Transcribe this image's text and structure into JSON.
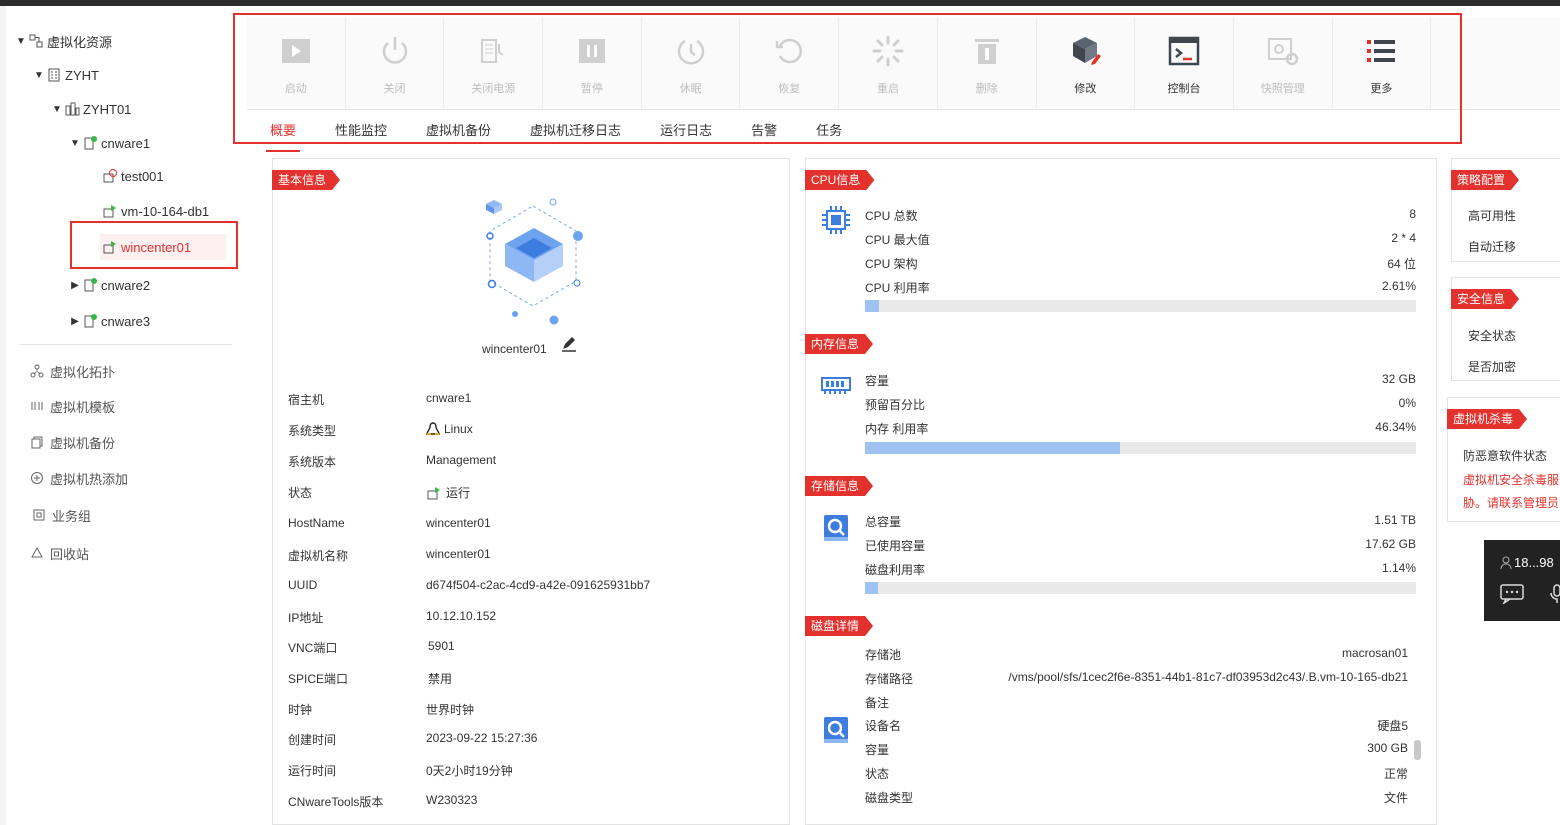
{
  "sidebar": {
    "tree": {
      "root": "虚拟化资源",
      "cluster": "ZYHT",
      "host_group": "ZYHT01",
      "host1": "cnware1",
      "vm1": "test001",
      "vm2": "vm-10-164-db1",
      "vm3": "wincenter01",
      "host2": "cnware2",
      "host3": "cnware3"
    },
    "menu": [
      "虚拟化拓扑",
      "虚拟机模板",
      "虚拟机备份",
      "虚拟机热添加",
      "业务组",
      "回收站"
    ]
  },
  "toolbar": {
    "buttons": [
      {
        "label": "启动",
        "icon": "play-icon"
      },
      {
        "label": "关闭",
        "icon": "power-icon"
      },
      {
        "label": "关闭电源",
        "icon": "power-plug-icon"
      },
      {
        "label": "暂停",
        "icon": "pause-icon"
      },
      {
        "label": "休眠",
        "icon": "sleep-icon"
      },
      {
        "label": "恢复",
        "icon": "restore-icon"
      },
      {
        "label": "重启",
        "icon": "restart-icon"
      },
      {
        "label": "删除",
        "icon": "trash-icon"
      },
      {
        "label": "修改",
        "icon": "cube-edit-icon"
      },
      {
        "label": "控制台",
        "icon": "console-icon"
      },
      {
        "label": "快照管理",
        "icon": "snapshot-icon"
      },
      {
        "label": "更多",
        "icon": "menu-list-icon"
      }
    ]
  },
  "tabs": [
    "概要",
    "性能监控",
    "虚拟机备份",
    "虚拟机迁移日志",
    "运行日志",
    "告警",
    "任务"
  ],
  "basic": {
    "tag": "基本信息",
    "vm_name": "wincenter01",
    "rows": [
      {
        "label": "宿主机",
        "value": "cnware1"
      },
      {
        "label": "系统类型",
        "value": "Linux"
      },
      {
        "label": "系统版本",
        "value": "Management"
      },
      {
        "label": "状态",
        "value": "运行"
      },
      {
        "label": "HostName",
        "value": "wincenter01"
      },
      {
        "label": "虚拟机名称",
        "value": "wincenter01"
      },
      {
        "label": "UUID",
        "value": "d674f504-c2ac-4cd9-a42e-091625931bb7"
      },
      {
        "label": "IP地址",
        "value": "10.12.10.152"
      },
      {
        "label": "VNC端口",
        "value": "5901"
      },
      {
        "label": "SPICE端口",
        "value": "禁用"
      },
      {
        "label": "时钟",
        "value": "世界时钟"
      },
      {
        "label": "创建时间",
        "value": "2023-09-22 15:27:36"
      },
      {
        "label": "运行时间",
        "value": "0天2小时19分钟"
      },
      {
        "label": "CNwareTools版本",
        "value": "W230323"
      }
    ]
  },
  "cpu": {
    "tag": "CPU信息",
    "rows": [
      {
        "label": "CPU 总数",
        "value": "8"
      },
      {
        "label": "CPU 最大值",
        "value": "2 * 4"
      },
      {
        "label": "CPU 架构",
        "value": "64 位"
      },
      {
        "label": "CPU 利用率",
        "value": "2.61%"
      }
    ],
    "usage": 2.61
  },
  "memory": {
    "tag": "内存信息",
    "rows": [
      {
        "label": "容量",
        "value": "32 GB"
      },
      {
        "label": "预留百分比",
        "value": "0%"
      },
      {
        "label": "内存 利用率",
        "value": "46.34%"
      }
    ],
    "usage": 46.34
  },
  "storage": {
    "tag": "存储信息",
    "rows": [
      {
        "label": "总容量",
        "value": "1.51 TB"
      },
      {
        "label": "已使用容量",
        "value": "17.62 GB"
      },
      {
        "label": "磁盘利用率",
        "value": "1.14%"
      }
    ],
    "usage": 1.14
  },
  "disk": {
    "tag": "磁盘详情",
    "rows": [
      {
        "label": "存储池",
        "value": "macrosan01"
      },
      {
        "label": "存储路径",
        "value": "/vms/pool/sfs/1cec2f6e-8351-44b1-81c7-df03953d2c43/.B.vm-10-165-db21"
      },
      {
        "label": "备注",
        "value": ""
      },
      {
        "label": "设备名",
        "value": "硬盘5"
      },
      {
        "label": "容量",
        "value": "300 GB"
      },
      {
        "label": "状态",
        "value": "正常"
      },
      {
        "label": "磁盘类型",
        "value": "文件"
      }
    ]
  },
  "right": {
    "policy_tag": "策略配置",
    "policy": [
      "高可用性",
      "自动迁移"
    ],
    "security_tag": "安全信息",
    "security": [
      "安全状态",
      "是否加密"
    ],
    "antivirus_tag": "虚拟机杀毒",
    "antivirus_label": "防恶意软件状态",
    "warning_line1": "虚拟机安全杀毒服务",
    "warning_line2": "胁。请联系管理员"
  },
  "floating": {
    "ip": "18...98"
  },
  "colors": {
    "accent": "#e3312d",
    "bar_fill": "#9ec3f3",
    "bar_track": "#e9e9e9"
  }
}
